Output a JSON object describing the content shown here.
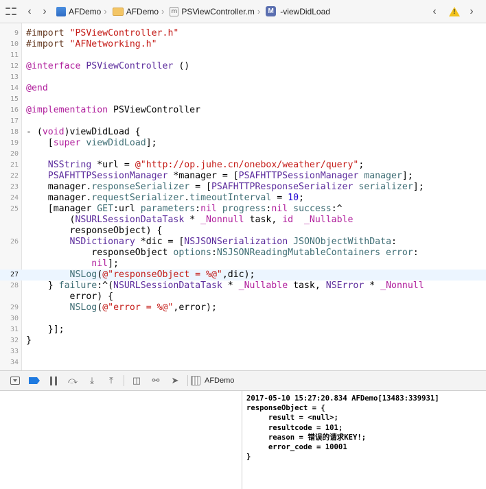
{
  "jumpbar": {
    "crumbs": [
      "AFDemo",
      "AFDemo",
      "PSViewController.m",
      "-viewDidLoad"
    ],
    "method_badge": "M",
    "file_badge": "m"
  },
  "editor": {
    "current_line": 27,
    "colors": {
      "keyword": "#b01e9c",
      "string": "#c41a16",
      "type": "#5b2b9c",
      "method": "#3e6d74",
      "preprocessor": "#643820",
      "number": "#1c00cf",
      "current_line_bg": "#ecf5ff"
    },
    "lines": [
      {
        "n": "9",
        "t": [
          [
            "pre",
            "#import "
          ],
          [
            "str",
            "\"PSViewController.h\""
          ]
        ]
      },
      {
        "n": "10",
        "t": [
          [
            "pre",
            "#import "
          ],
          [
            "str",
            "\"AFNetworking.h\""
          ]
        ]
      },
      {
        "n": "11",
        "t": []
      },
      {
        "n": "12",
        "t": [
          [
            "kw",
            "@interface"
          ],
          [
            "plain",
            " "
          ],
          [
            "type",
            "PSViewController"
          ],
          [
            "plain",
            " ()"
          ]
        ]
      },
      {
        "n": "13",
        "t": []
      },
      {
        "n": "14",
        "t": [
          [
            "kw",
            "@end"
          ]
        ]
      },
      {
        "n": "15",
        "t": []
      },
      {
        "n": "16",
        "t": [
          [
            "kw",
            "@implementation"
          ],
          [
            "plain",
            " PSViewController"
          ]
        ]
      },
      {
        "n": "17",
        "t": []
      },
      {
        "n": "18",
        "t": [
          [
            "plain",
            "- ("
          ],
          [
            "kw",
            "void"
          ],
          [
            "plain",
            ")viewDidLoad {"
          ]
        ]
      },
      {
        "n": "19",
        "t": [
          [
            "plain",
            "    ["
          ],
          [
            "kw",
            "super"
          ],
          [
            "plain",
            " "
          ],
          [
            "meth",
            "viewDidLoad"
          ],
          [
            "plain",
            "];"
          ]
        ]
      },
      {
        "n": "20",
        "t": []
      },
      {
        "n": "21",
        "t": [
          [
            "plain",
            "    "
          ],
          [
            "type",
            "NSString"
          ],
          [
            "plain",
            " *url = "
          ],
          [
            "str",
            "@\"http://op.juhe.cn/onebox/weather/query\""
          ],
          [
            "plain",
            ";"
          ]
        ]
      },
      {
        "n": "22",
        "t": [
          [
            "plain",
            "    "
          ],
          [
            "type",
            "PSAFHTTPSessionManager"
          ],
          [
            "plain",
            " *manager = ["
          ],
          [
            "type",
            "PSAFHTTPSessionManager"
          ],
          [
            "plain",
            " "
          ],
          [
            "meth",
            "manager"
          ],
          [
            "plain",
            "];"
          ]
        ]
      },
      {
        "n": "23",
        "t": [
          [
            "plain",
            "    manager."
          ],
          [
            "meth",
            "responseSerializer"
          ],
          [
            "plain",
            " = ["
          ],
          [
            "type",
            "PSAFHTTPResponseSerializer"
          ],
          [
            "plain",
            " "
          ],
          [
            "meth",
            "serializer"
          ],
          [
            "plain",
            "];"
          ]
        ]
      },
      {
        "n": "24",
        "t": [
          [
            "plain",
            "    manager."
          ],
          [
            "meth",
            "requestSerializer"
          ],
          [
            "plain",
            "."
          ],
          [
            "meth",
            "timeoutInterval"
          ],
          [
            "plain",
            " = "
          ],
          [
            "num",
            "10"
          ],
          [
            "plain",
            ";"
          ]
        ]
      },
      {
        "n": "25",
        "t": [
          [
            "plain",
            "    [manager "
          ],
          [
            "meth",
            "GET"
          ],
          [
            "plain",
            ":url "
          ],
          [
            "meth",
            "parameters"
          ],
          [
            "plain",
            ":"
          ],
          [
            "kw",
            "nil"
          ],
          [
            "plain",
            " "
          ],
          [
            "meth",
            "progress"
          ],
          [
            "plain",
            ":"
          ],
          [
            "kw",
            "nil"
          ],
          [
            "plain",
            " "
          ],
          [
            "meth",
            "success"
          ],
          [
            "plain",
            ":^"
          ]
        ]
      },
      {
        "n": "",
        "t": [
          [
            "plain",
            "        ("
          ],
          [
            "type",
            "NSURLSessionDataTask"
          ],
          [
            "plain",
            " * "
          ],
          [
            "kw",
            "_Nonnull"
          ],
          [
            "plain",
            " task, "
          ],
          [
            "kw",
            "id"
          ],
          [
            "plain",
            "  "
          ],
          [
            "kw",
            "_Nullable"
          ]
        ]
      },
      {
        "n": "",
        "t": [
          [
            "plain",
            "        responseObject) {"
          ]
        ]
      },
      {
        "n": "26",
        "t": [
          [
            "plain",
            "        "
          ],
          [
            "type",
            "NSDictionary"
          ],
          [
            "plain",
            " *dic = ["
          ],
          [
            "type",
            "NSJSONSerialization"
          ],
          [
            "plain",
            " "
          ],
          [
            "meth",
            "JSONObjectWithData"
          ],
          [
            "plain",
            ":"
          ]
        ]
      },
      {
        "n": "",
        "t": [
          [
            "plain",
            "            responseObject "
          ],
          [
            "meth",
            "options"
          ],
          [
            "plain",
            ":"
          ],
          [
            "meth",
            "NSJSONReadingMutableContainers"
          ],
          [
            "plain",
            " "
          ],
          [
            "meth",
            "error"
          ],
          [
            "plain",
            ":"
          ]
        ]
      },
      {
        "n": "",
        "t": [
          [
            "plain",
            "            "
          ],
          [
            "kw",
            "nil"
          ],
          [
            "plain",
            "];"
          ]
        ]
      },
      {
        "n": "27",
        "t": [
          [
            "plain",
            "        "
          ],
          [
            "meth",
            "NSLog"
          ],
          [
            "plain",
            "("
          ],
          [
            "str",
            "@\"responseObject = %@\""
          ],
          [
            "plain",
            ",dic);"
          ]
        ]
      },
      {
        "n": "28",
        "t": [
          [
            "plain",
            "    } "
          ],
          [
            "meth",
            "failure"
          ],
          [
            "plain",
            ":^("
          ],
          [
            "type",
            "NSURLSessionDataTask"
          ],
          [
            "plain",
            " * "
          ],
          [
            "kw",
            "_Nullable"
          ],
          [
            "plain",
            " task, "
          ],
          [
            "type",
            "NSError"
          ],
          [
            "plain",
            " * "
          ],
          [
            "kw",
            "_Nonnull"
          ]
        ]
      },
      {
        "n": "",
        "t": [
          [
            "plain",
            "        error) {"
          ]
        ]
      },
      {
        "n": "29",
        "t": [
          [
            "plain",
            "        "
          ],
          [
            "meth",
            "NSLog"
          ],
          [
            "plain",
            "("
          ],
          [
            "str",
            "@\"error = %@\""
          ],
          [
            "plain",
            ",error);"
          ]
        ]
      },
      {
        "n": "30",
        "t": []
      },
      {
        "n": "31",
        "t": [
          [
            "plain",
            "    }];"
          ]
        ]
      },
      {
        "n": "32",
        "t": [
          [
            "plain",
            "}"
          ]
        ]
      },
      {
        "n": "33",
        "t": []
      },
      {
        "n": "34",
        "t": []
      }
    ]
  },
  "debugbar": {
    "target": "AFDemo"
  },
  "console": {
    "lines": [
      "2017-05-10 15:27:20.834 AFDemo[13483:339931]",
      "responseObject = {",
      "     result = <null>;",
      "     resultcode = 101;",
      "     reason = 错误的请求KEY!;",
      "     error_code = 10001",
      "}"
    ]
  }
}
